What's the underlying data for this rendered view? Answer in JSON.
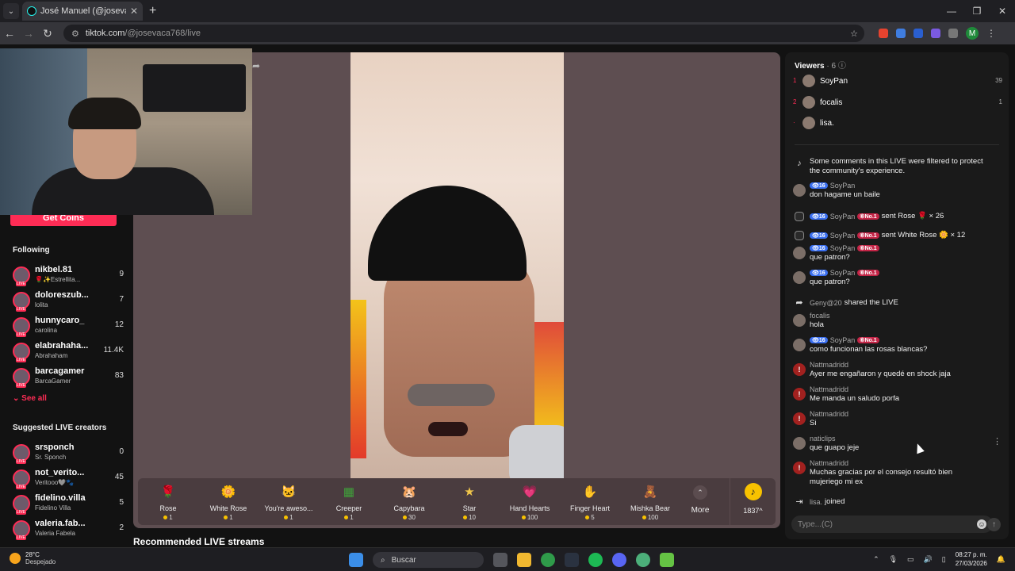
{
  "browser": {
    "tab_title": "José Manuel (@josevaca768",
    "tab_close": "✕",
    "new_tab": "+",
    "url_domain": "tiktok.com",
    "url_path": "/@josevaca768/live",
    "profile_initial": "M",
    "win_min": "—",
    "win_max": "❐",
    "win_close": "✕"
  },
  "sidebar": {
    "get_coins": "Get Coins",
    "following_title": "Following",
    "following": [
      {
        "name": "nikbel.81",
        "sub": "🌹✨Estrellita...",
        "count": "9"
      },
      {
        "name": "doloreszub...",
        "sub": "lolita",
        "count": "7"
      },
      {
        "name": "hunnycaro_",
        "sub": "carolina",
        "count": "12"
      },
      {
        "name": "elabrahaha...",
        "sub": "Abrahaham",
        "count": "11.4K"
      },
      {
        "name": "barcagamer",
        "sub": "BarcaGamer",
        "count": "83"
      }
    ],
    "see_all": "See all",
    "suggested_title": "Suggested LIVE creators",
    "suggested": [
      {
        "name": "srsponch",
        "sub": "Sr. Sponch",
        "count": "0"
      },
      {
        "name": "not_verito...",
        "sub": "Veritooo🩶🐾",
        "count": "45"
      },
      {
        "name": "fidelino.villa",
        "sub": "Fidelino Villa",
        "count": "5"
      },
      {
        "name": "valeria.fab...",
        "sub": "Valeria Fabela",
        "count": "2"
      }
    ]
  },
  "gifts": [
    {
      "name": "Rose",
      "price": "1",
      "icon": "🌹",
      "color": "#c0395a"
    },
    {
      "name": "White Rose",
      "price": "1",
      "icon": "🌼",
      "color": "#e8e4d6"
    },
    {
      "name": "You're aweso...",
      "price": "1",
      "icon": "🐱",
      "color": "#d8b48a"
    },
    {
      "name": "Creeper",
      "price": "1",
      "icon": "▦",
      "color": "#3fa33a"
    },
    {
      "name": "Capybara",
      "price": "30",
      "icon": "🐹",
      "color": "#b77b45"
    },
    {
      "name": "Star",
      "price": "10",
      "icon": "★",
      "color": "#f0c64a"
    },
    {
      "name": "Hand Hearts",
      "price": "100",
      "icon": "💗",
      "color": "#e88bd0"
    },
    {
      "name": "Finger Heart",
      "price": "5",
      "icon": "✋",
      "color": "#e65a55"
    },
    {
      "name": "Mishka Bear",
      "price": "100",
      "icon": "🧸",
      "color": "#b84a3a"
    }
  ],
  "more_label": "More",
  "coin_balance": "1837",
  "recommended": "Recommended LIVE streams",
  "viewers": {
    "title": "Viewers",
    "count": "· 6",
    "list": [
      {
        "rank": "1",
        "name": "SoyPan",
        "score": "39"
      },
      {
        "rank": "2",
        "name": "focalis",
        "score": "1"
      },
      {
        "rank": "·",
        "name": "lisa.",
        "score": ""
      }
    ]
  },
  "comments": [
    {
      "type": "sys",
      "text": "Some comments in this LIVE were filtered to protect",
      "text2": "the community's experience."
    },
    {
      "type": "msg",
      "user": "SoyPan",
      "lvl": "16",
      "no1": "",
      "text": "don hagame un baile"
    },
    {
      "type": "gift",
      "user": "SoyPan",
      "lvl": "16",
      "no1": "No.1",
      "text": "sent Rose 🌹 × 26"
    },
    {
      "type": "gift",
      "user": "SoyPan",
      "lvl": "16",
      "no1": "No.1",
      "text": "sent White Rose 🌼 × 12"
    },
    {
      "type": "msg",
      "user": "SoyPan",
      "lvl": "16",
      "no1": "No.1",
      "text": "que patron?"
    },
    {
      "type": "msg",
      "user": "SoyPan",
      "lvl": "16",
      "no1": "No.1",
      "text": "que patron?"
    },
    {
      "type": "share",
      "user": "Geny@20",
      "text": "shared the LIVE"
    },
    {
      "type": "msg",
      "user": "focalis",
      "lvl": "",
      "no1": "",
      "text": "hola"
    },
    {
      "type": "msg",
      "user": "SoyPan",
      "lvl": "16",
      "no1": "No.1",
      "text": "como funcionan las rosas blancas?"
    },
    {
      "type": "warn",
      "user": "Nattmadridd",
      "text": "Ayer me engañaron y quedé en shock jaja"
    },
    {
      "type": "warn",
      "user": "Nattmadridd",
      "text": "Me manda un saludo porfa"
    },
    {
      "type": "warn",
      "user": "Nattmadridd",
      "text": "Si"
    },
    {
      "type": "msg",
      "user": "naticlips",
      "lvl": "",
      "no1": "",
      "text": "que guapo jeje"
    },
    {
      "type": "warn",
      "user": "Nattmadridd",
      "text": "Muchas gracias por el consejo resultó bien",
      "text2": "mujeriego mi ex"
    },
    {
      "type": "join",
      "user": "lisa.",
      "text": "joined"
    }
  ],
  "composer": {
    "placeholder": "Type...(C)"
  },
  "taskbar": {
    "temp": "28°C",
    "weather": "Despejado",
    "search": "Buscar",
    "time": "08:27 p. m.",
    "date": "27/03/2026"
  }
}
